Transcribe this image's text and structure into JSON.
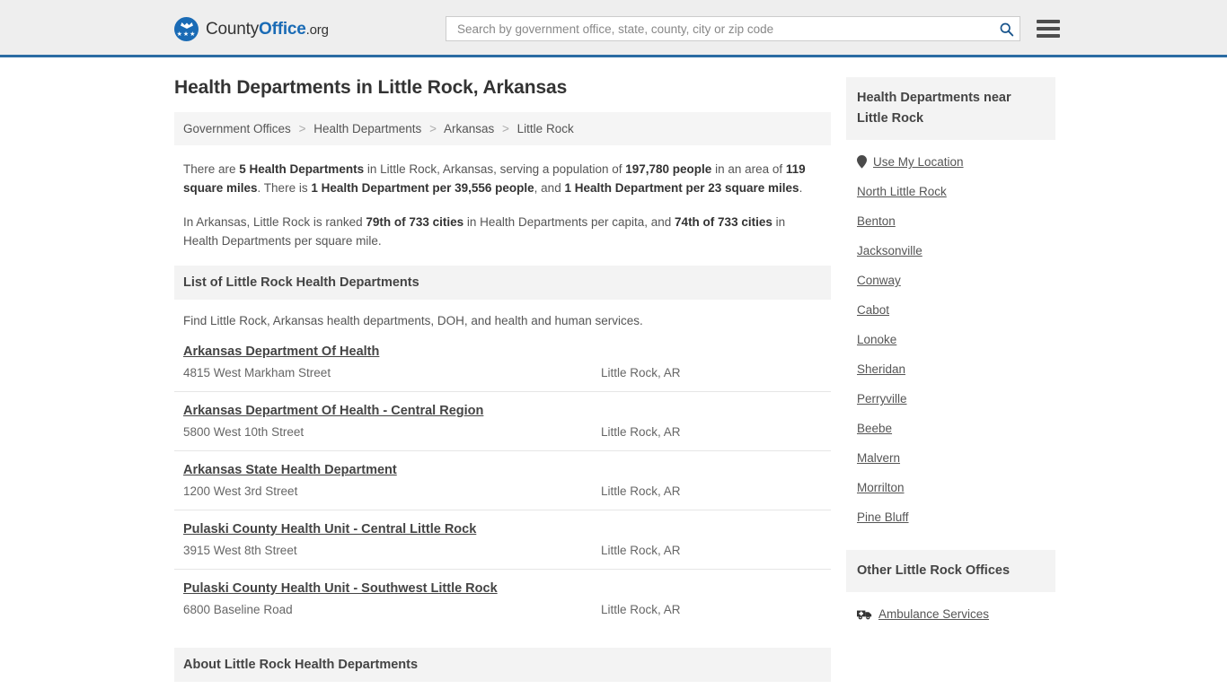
{
  "header": {
    "logo": {
      "part1": "County",
      "part2": "Office",
      "part3": ".org",
      "icon": "eagle-shield-icon",
      "stars": "★★★"
    },
    "search": {
      "placeholder": "Search by government office, state, county, city or zip code",
      "value": "",
      "icon": "search-icon"
    },
    "menu_icon": "hamburger-menu-icon",
    "accent_color": "#2b6ca3",
    "background_color": "#eeeeee"
  },
  "page_title": "Health Departments in Little Rock, Arkansas",
  "breadcrumb": {
    "items": [
      {
        "label": "Government Offices"
      },
      {
        "label": "Health Departments"
      },
      {
        "label": "Arkansas"
      },
      {
        "label": "Little Rock"
      }
    ],
    "separator": ">"
  },
  "summary": {
    "paragraph1": {
      "segments": [
        {
          "text": "There are ",
          "bold": false
        },
        {
          "text": "5 Health Departments",
          "bold": true
        },
        {
          "text": " in Little Rock, Arkansas, serving a population of ",
          "bold": false
        },
        {
          "text": "197,780 people",
          "bold": true
        },
        {
          "text": " in an area of ",
          "bold": false
        },
        {
          "text": "119 square miles",
          "bold": true
        },
        {
          "text": ". There is ",
          "bold": false
        },
        {
          "text": "1 Health Department per 39,556 people",
          "bold": true
        },
        {
          "text": ", and ",
          "bold": false
        },
        {
          "text": "1 Health Department per 23 square miles",
          "bold": true
        },
        {
          "text": ".",
          "bold": false
        }
      ]
    },
    "paragraph2": {
      "segments": [
        {
          "text": "In Arkansas, Little Rock is ranked ",
          "bold": false
        },
        {
          "text": "79th of 733 cities",
          "bold": true
        },
        {
          "text": " in Health Departments per capita, and ",
          "bold": false
        },
        {
          "text": "74th of 733 cities",
          "bold": true
        },
        {
          "text": " in Health Departments per square mile.",
          "bold": false
        }
      ]
    }
  },
  "list_section": {
    "header": "List of Little Rock Health Departments",
    "subtitle": "Find Little Rock, Arkansas health departments, DOH, and health and human services.",
    "listings": [
      {
        "name": "Arkansas Department Of Health",
        "address": "4815 West Markham Street",
        "city": "Little Rock, AR"
      },
      {
        "name": "Arkansas Department Of Health - Central Region",
        "address": "5800 West 10th Street",
        "city": "Little Rock, AR"
      },
      {
        "name": "Arkansas State Health Department",
        "address": "1200 West 3rd Street",
        "city": "Little Rock, AR"
      },
      {
        "name": "Pulaski County Health Unit - Central Little Rock",
        "address": "3915 West 8th Street",
        "city": "Little Rock, AR"
      },
      {
        "name": "Pulaski County Health Unit - Southwest Little Rock",
        "address": "6800 Baseline Road",
        "city": "Little Rock, AR"
      }
    ]
  },
  "about_section": {
    "header": "About Little Rock Health Departments"
  },
  "sidebar": {
    "nearby": {
      "header": "Health Departments near Little Rock",
      "use_my_location": {
        "label": "Use My Location",
        "icon": "map-pin-icon"
      },
      "cities": [
        {
          "label": "North Little Rock"
        },
        {
          "label": "Benton"
        },
        {
          "label": "Jacksonville"
        },
        {
          "label": "Conway"
        },
        {
          "label": "Cabot"
        },
        {
          "label": "Lonoke"
        },
        {
          "label": "Sheridan"
        },
        {
          "label": "Perryville"
        },
        {
          "label": "Beebe"
        },
        {
          "label": "Malvern"
        },
        {
          "label": "Morrilton"
        },
        {
          "label": "Pine Bluff"
        }
      ]
    },
    "other_offices": {
      "header": "Other Little Rock Offices",
      "items": [
        {
          "label": "Ambulance Services",
          "icon": "ambulance-icon"
        }
      ]
    }
  }
}
